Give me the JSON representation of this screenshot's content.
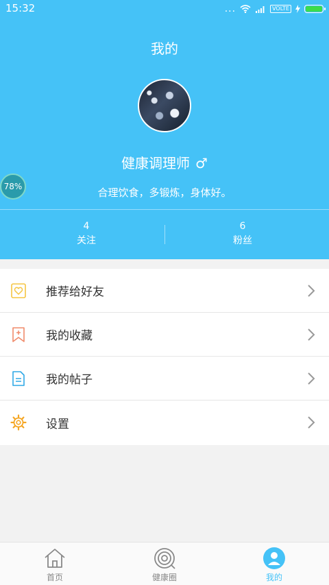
{
  "status_bar": {
    "time": "15:32",
    "dots": "...",
    "volte": "VOLTE"
  },
  "header": {
    "title": "我的"
  },
  "profile": {
    "name": "健康调理师",
    "gender_symbol": "♂",
    "bio": "合理饮食，多锻炼，身体好。"
  },
  "stats": [
    {
      "value": "4",
      "label": "关注"
    },
    {
      "value": "6",
      "label": "粉丝"
    }
  ],
  "floating_ball": {
    "text": "78%"
  },
  "menu": [
    {
      "label": "推荐给好友",
      "icon": "heart-card-icon"
    },
    {
      "label": "我的收藏",
      "icon": "bookmark-plus-icon"
    },
    {
      "label": "我的帖子",
      "icon": "document-icon"
    },
    {
      "label": "设置",
      "icon": "gear-icon"
    }
  ],
  "tabbar": [
    {
      "label": "首页",
      "icon": "home-icon"
    },
    {
      "label": "健康圈",
      "icon": "target-circle-icon"
    },
    {
      "label": "我的",
      "icon": "user-icon",
      "active": true
    }
  ],
  "colors": {
    "primary": "#45c2f7",
    "tab_inactive": "#888888",
    "heart_icon": "#f5c542",
    "bookmark_icon": "#f08a6a",
    "document_icon": "#2ea8e6",
    "gear_icon": "#f5a623"
  }
}
